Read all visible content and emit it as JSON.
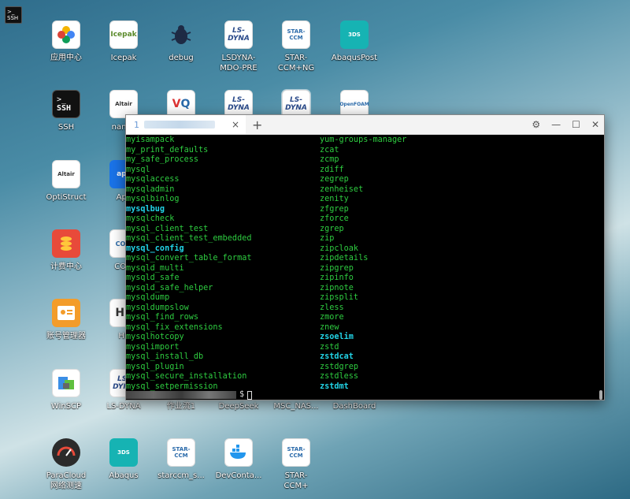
{
  "desktop": {
    "top_icon_label": "SSH",
    "icons": [
      {
        "label": "应用中心",
        "icon": "app-center-icon"
      },
      {
        "label": "Icepak",
        "icon": "icepak-icon"
      },
      {
        "label": "debug",
        "icon": "bug-icon"
      },
      {
        "label": "LSDYNA-\nMDO-PRE",
        "icon": "lsdyna-icon"
      },
      {
        "label": "STAR-\nCCM+NG",
        "icon": "starccm-icon"
      },
      {
        "label": "AbaqusPost",
        "icon": "abaqus-icon"
      },
      {
        "label": "SSH",
        "icon": "terminal-icon"
      },
      {
        "label": "nanoF",
        "icon": "altair-icon"
      },
      {
        "label": "OptiStruct",
        "icon": "optistruct-icon"
      },
      {
        "label": "Apc",
        "icon": "apc-icon"
      },
      {
        "label": "计费中心",
        "icon": "billing-icon"
      },
      {
        "label": "COM",
        "icon": "com-icon"
      },
      {
        "label": "账号管理器",
        "icon": "account-icon"
      },
      {
        "label": "HF",
        "icon": "hf-icon"
      },
      {
        "label": "WinSCP",
        "icon": "winscp-icon"
      },
      {
        "label": "LS-DYNA",
        "icon": "lsdyna-icon"
      },
      {
        "label": "作业流1",
        "icon": "workflow-icon"
      },
      {
        "label": "DeepSeek",
        "icon": "deepseek-icon"
      },
      {
        "label": "MSC_NAS...",
        "icon": "nastran-icon"
      },
      {
        "label": "DashBoard",
        "icon": "dashboard-icon"
      },
      {
        "label": "ParaCloud\n网络测速",
        "icon": "speedometer-icon"
      },
      {
        "label": "Abaqus",
        "icon": "abaqus-icon"
      },
      {
        "label": "starccm_s...",
        "icon": "starccm-icon"
      },
      {
        "label": "DevConta...",
        "icon": "docker-icon"
      },
      {
        "label": "STAR-\nCCM+",
        "icon": "starccm-icon"
      }
    ]
  },
  "terminal": {
    "tab_title": "1",
    "tab_close": "×",
    "new_tab": "+",
    "settings_icon": "⚙",
    "minimize": "—",
    "maximize": "☐",
    "close": "✕",
    "prompt_suffix": "$",
    "col1": [
      "myisampack",
      "my_print_defaults",
      "my_safe_process",
      "mysql",
      "mysqlaccess",
      "mysqladmin",
      "mysqlbinlog",
      "mysqlbug",
      "mysqlcheck",
      "mysql_client_test",
      "mysql_client_test_embedded",
      "mysql_config",
      "mysql_convert_table_format",
      "mysqld_multi",
      "mysqld_safe",
      "mysqld_safe_helper",
      "mysqldump",
      "mysqldumpslow",
      "mysql_find_rows",
      "mysql_fix_extensions",
      "mysqlhotcopy",
      "mysqlimport",
      "mysql_install_db",
      "mysql_plugin",
      "mysql_secure_installation",
      "mysql_setpermission"
    ],
    "col2": [
      "yum-groups-manager",
      "zcat",
      "zcmp",
      "zdiff",
      "zegrep",
      "zenheiset",
      "zenity",
      "zfgrep",
      "zforce",
      "zgrep",
      "zip",
      "zipcloak",
      "zipdetails",
      "zipgrep",
      "zipinfo",
      "zipnote",
      "zipsplit",
      "zless",
      "zmore",
      "znew",
      "zsoelim",
      "zstd",
      "zstdcat",
      "zstdgrep",
      "zstdless",
      "zstdmt"
    ],
    "exec_highlight_col1": [
      7,
      11
    ],
    "exec_highlight_col2": [
      20,
      22,
      25
    ]
  }
}
